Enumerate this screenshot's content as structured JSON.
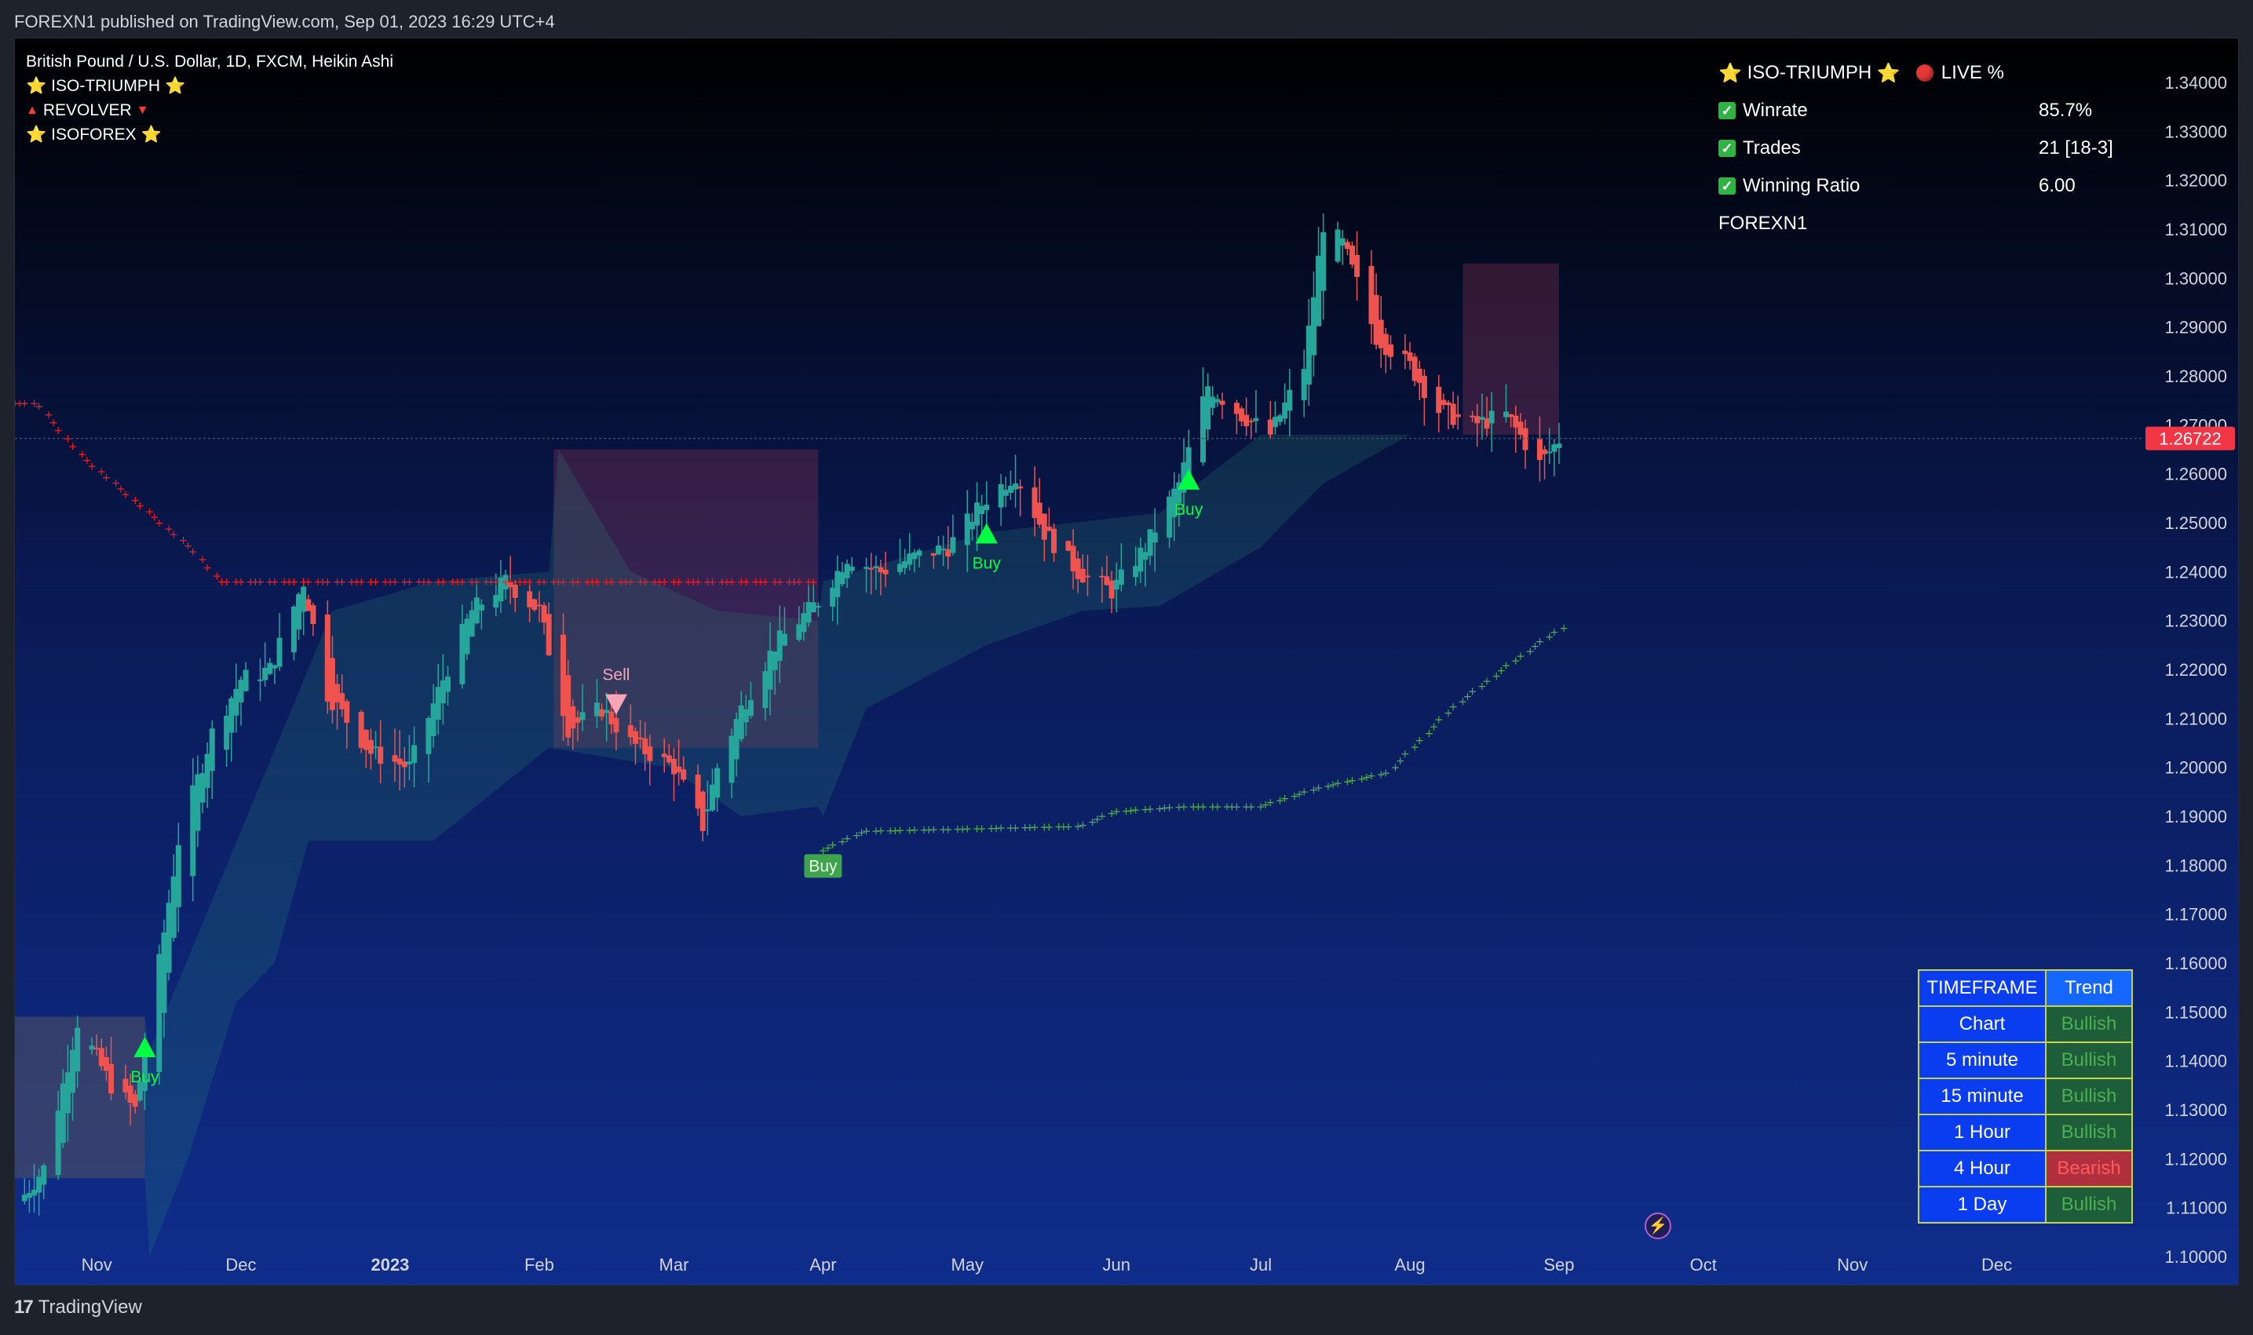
{
  "header": {
    "publish_line": "FOREXN1 published on TradingView.com, Sep 01, 2023 16:29 UTC+4"
  },
  "footer": {
    "brand": "TradingView",
    "brand_logo": "17"
  },
  "legend": {
    "symbol_line": "British Pound / U.S. Dollar, 1D, FXCM, Heikin Ashi",
    "indicators": [
      "ISO-TRIUMPH",
      "REVOLVER",
      "ISOFOREX"
    ]
  },
  "stats_panel": {
    "title": "ISO-TRIUMPH",
    "live_label": "LIVE %",
    "rows": [
      {
        "label": "Winrate",
        "value": "85.7%"
      },
      {
        "label": "Trades",
        "value": "21 [18-3]"
      },
      {
        "label": "Winning Ratio",
        "value": "6.00"
      }
    ],
    "author": "FOREXN1"
  },
  "trend_table": {
    "headers": [
      "TIMEFRAME",
      "Trend"
    ],
    "rows": [
      {
        "timeframe": "Chart",
        "trend": "Bullish"
      },
      {
        "timeframe": "5 minute",
        "trend": "Bullish"
      },
      {
        "timeframe": "15 minute",
        "trend": "Bullish"
      },
      {
        "timeframe": "1 Hour",
        "trend": "Bullish"
      },
      {
        "timeframe": "4 Hour",
        "trend": "Bearish"
      },
      {
        "timeframe": "1 Day",
        "trend": "Bullish"
      }
    ]
  },
  "colors": {
    "bull_candle": "#26a69a",
    "bear_candle": "#ef5350",
    "bg_top": "#000000",
    "bg_bottom": "#0f2d8c",
    "price_badge": "#f23645",
    "resistance_line": "#ff1a1a",
    "support_line": "#4caf50",
    "buy_signal": "#00ff40",
    "sell_signal": "#f7a6b8"
  },
  "chart_data": {
    "type": "candlestick",
    "chart_style": "Heikin Ashi",
    "symbol": "GBPUSD",
    "timeframe": "1D",
    "current_price": "1.26722",
    "y_range": [
      1.095,
      1.348
    ],
    "y_ticks": [
      "1.34000",
      "1.33000",
      "1.32000",
      "1.31000",
      "1.30000",
      "1.29000",
      "1.28000",
      "1.27000",
      "1.26000",
      "1.25000",
      "1.24000",
      "1.23000",
      "1.22000",
      "1.21000",
      "1.20000",
      "1.19000",
      "1.18000",
      "1.17000",
      "1.16000",
      "1.15000",
      "1.14000",
      "1.13000",
      "1.12000",
      "1.11000",
      "1.10000"
    ],
    "x_ticks": [
      {
        "label": "Nov",
        "date": "2022-11-01",
        "bold": false
      },
      {
        "label": "Dec",
        "date": "2022-12-01",
        "bold": false
      },
      {
        "label": "2023",
        "date": "2023-01-01",
        "bold": true
      },
      {
        "label": "Feb",
        "date": "2023-02-01",
        "bold": false
      },
      {
        "label": "Mar",
        "date": "2023-03-01",
        "bold": false
      },
      {
        "label": "Apr",
        "date": "2023-04-01",
        "bold": false
      },
      {
        "label": "May",
        "date": "2023-05-01",
        "bold": false
      },
      {
        "label": "Jun",
        "date": "2023-06-01",
        "bold": false
      },
      {
        "label": "Jul",
        "date": "2023-07-01",
        "bold": false
      },
      {
        "label": "Aug",
        "date": "2023-08-01",
        "bold": false
      },
      {
        "label": "Sep",
        "date": "2023-09-01",
        "bold": false
      },
      {
        "label": "Oct",
        "date": "2023-10-01",
        "bold": false
      },
      {
        "label": "Nov",
        "date": "2023-11-01",
        "bold": false
      },
      {
        "label": "Dec",
        "date": "2023-12-01",
        "bold": false
      }
    ],
    "price_path": [
      [
        "2022-10-15",
        1.11
      ],
      [
        "2022-10-21",
        1.118
      ],
      [
        "2022-10-28",
        1.148
      ],
      [
        "2022-11-04",
        1.135
      ],
      [
        "2022-11-09",
        1.13
      ],
      [
        "2022-11-14",
        1.16
      ],
      [
        "2022-11-18",
        1.185
      ],
      [
        "2022-11-25",
        1.207
      ],
      [
        "2022-12-01",
        1.218
      ],
      [
        "2022-12-07",
        1.22
      ],
      [
        "2022-12-14",
        1.238
      ],
      [
        "2022-12-19",
        1.215
      ],
      [
        "2022-12-28",
        1.203
      ],
      [
        "2023-01-05",
        1.2
      ],
      [
        "2023-01-12",
        1.218
      ],
      [
        "2023-01-18",
        1.232
      ],
      [
        "2023-01-25",
        1.238
      ],
      [
        "2023-02-01",
        1.232
      ],
      [
        "2023-02-07",
        1.208
      ],
      [
        "2023-02-14",
        1.212
      ],
      [
        "2023-02-20",
        1.205
      ],
      [
        "2023-03-01",
        1.2
      ],
      [
        "2023-03-07",
        1.188
      ],
      [
        "2023-03-10",
        1.2
      ],
      [
        "2023-03-15",
        1.212
      ],
      [
        "2023-03-22",
        1.225
      ],
      [
        "2023-03-31",
        1.234
      ],
      [
        "2023-04-06",
        1.243
      ],
      [
        "2023-04-13",
        1.24
      ],
      [
        "2023-04-20",
        1.243
      ],
      [
        "2023-04-27",
        1.245
      ],
      [
        "2023-05-05",
        1.255
      ],
      [
        "2023-05-11",
        1.26
      ],
      [
        "2023-05-17",
        1.248
      ],
      [
        "2023-05-24",
        1.24
      ],
      [
        "2023-05-31",
        1.236
      ],
      [
        "2023-06-07",
        1.245
      ],
      [
        "2023-06-14",
        1.258
      ],
      [
        "2023-06-20",
        1.278
      ],
      [
        "2023-06-27",
        1.272
      ],
      [
        "2023-07-03",
        1.268
      ],
      [
        "2023-07-10",
        1.282
      ],
      [
        "2023-07-14",
        1.311
      ],
      [
        "2023-07-18",
        1.307
      ],
      [
        "2023-07-25",
        1.288
      ],
      [
        "2023-08-01",
        1.282
      ],
      [
        "2023-08-07",
        1.273
      ],
      [
        "2023-08-14",
        1.27
      ],
      [
        "2023-08-21",
        1.272
      ],
      [
        "2023-08-28",
        1.262
      ],
      [
        "2023-09-01",
        1.267
      ]
    ],
    "cloud_upper": [
      [
        "2022-10-15",
        1.149
      ],
      [
        "2022-11-11",
        1.149
      ],
      [
        "2022-11-12",
        1.142
      ],
      [
        "2022-12-20",
        1.232
      ],
      [
        "2023-01-10",
        1.238
      ],
      [
        "2023-02-03",
        1.24
      ],
      [
        "2023-02-05",
        1.265
      ],
      [
        "2023-02-20",
        1.24
      ],
      [
        "2023-03-10",
        1.232
      ],
      [
        "2023-03-31",
        1.23
      ],
      [
        "2023-04-01",
        1.238
      ],
      [
        "2023-05-05",
        1.248
      ],
      [
        "2023-06-10",
        1.252
      ],
      [
        "2023-07-01",
        1.268
      ],
      [
        "2023-08-31",
        1.268
      ]
    ],
    "cloud_lower": [
      [
        "2022-10-15",
        1.116
      ],
      [
        "2022-11-11",
        1.116
      ],
      [
        "2022-11-12",
        1.1
      ],
      [
        "2022-11-20",
        1.12
      ],
      [
        "2022-11-30",
        1.152
      ],
      [
        "2022-12-08",
        1.16
      ],
      [
        "2022-12-15",
        1.185
      ],
      [
        "2023-01-10",
        1.185
      ],
      [
        "2023-02-03",
        1.204
      ],
      [
        "2023-02-28",
        1.2
      ],
      [
        "2023-03-15",
        1.19
      ],
      [
        "2023-03-31",
        1.192
      ],
      [
        "2023-04-01",
        1.19
      ],
      [
        "2023-04-10",
        1.212
      ],
      [
        "2023-05-05",
        1.225
      ],
      [
        "2023-05-25",
        1.232
      ],
      [
        "2023-06-10",
        1.233
      ],
      [
        "2023-07-01",
        1.245
      ],
      [
        "2023-07-14",
        1.258
      ],
      [
        "2023-08-01",
        1.268
      ],
      [
        "2023-08-31",
        1.268
      ]
    ],
    "bear_zones": [
      {
        "from": "2022-10-15",
        "to": "2022-11-11",
        "top": 1.149,
        "bottom": 1.116
      },
      {
        "from": "2023-02-04",
        "to": "2023-03-31",
        "top": 1.265,
        "bottom": 1.204
      },
      {
        "from": "2023-08-12",
        "to": "2023-09-01",
        "top": 1.303,
        "bottom": 1.268
      }
    ],
    "resistance_dots": [
      [
        "2022-10-15",
        1.2745
      ],
      [
        "2022-10-20",
        1.2745
      ],
      [
        "2022-10-29",
        1.264
      ],
      [
        "2022-11-10",
        1.254
      ],
      [
        "2022-11-22",
        1.244
      ],
      [
        "2022-11-27",
        1.238
      ],
      [
        "2023-03-31",
        1.238
      ]
    ],
    "support_dots": [
      [
        "2023-04-01",
        1.183
      ],
      [
        "2023-04-10",
        1.187
      ],
      [
        "2023-05-25",
        1.188
      ],
      [
        "2023-06-01",
        1.191
      ],
      [
        "2023-06-15",
        1.192
      ],
      [
        "2023-07-01",
        1.192
      ],
      [
        "2023-07-14",
        1.196
      ],
      [
        "2023-07-28",
        1.199
      ],
      [
        "2023-08-10",
        1.212
      ],
      [
        "2023-08-22",
        1.221
      ],
      [
        "2023-09-01",
        1.228
      ],
      [
        "2023-09-03",
        1.229
      ]
    ],
    "signals": [
      {
        "type": "buy",
        "label": "Buy",
        "date": "2022-11-11",
        "price": 1.143,
        "style": "triangle"
      },
      {
        "type": "sell",
        "label": "Sell",
        "date": "2023-02-17",
        "price": 1.213,
        "style": "triangle"
      },
      {
        "type": "buy",
        "label": "Buy",
        "date": "2023-04-01",
        "price": 1.18,
        "style": "box"
      },
      {
        "type": "buy",
        "label": "Buy",
        "date": "2023-05-05",
        "price": 1.248,
        "style": "triangle"
      },
      {
        "type": "buy",
        "label": "Buy",
        "date": "2023-06-16",
        "price": 1.259,
        "style": "triangle"
      }
    ]
  }
}
